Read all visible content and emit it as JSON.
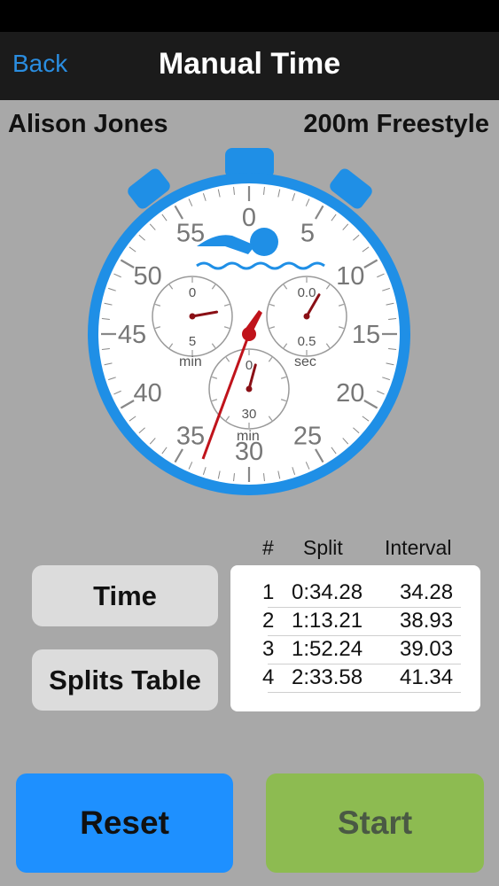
{
  "nav": {
    "back_label": "Back",
    "title": "Manual Time"
  },
  "swimmer": {
    "name": "Alison Jones",
    "event": "200m Freestyle"
  },
  "stopwatch": {
    "main_dial_labels": [
      "0",
      "5",
      "10",
      "15",
      "20",
      "25",
      "30",
      "35",
      "40",
      "45",
      "50",
      "55"
    ],
    "left_subdial": {
      "top": "0",
      "bottom": "5",
      "unit": "min"
    },
    "right_subdial": {
      "top": "0.0",
      "bottom": "0.5",
      "unit": "sec"
    },
    "bottom_subdial": {
      "top": "0",
      "bottom": "30",
      "unit": "min"
    },
    "colors": {
      "case": "#1f8fe6",
      "hand": "#c0131b",
      "swimmer_icon": "#1f8fe6"
    }
  },
  "buttons": {
    "time": "Time",
    "splits_table": "Splits Table",
    "reset": "Reset",
    "start": "Start"
  },
  "splits": {
    "headers": {
      "num": "#",
      "split": "Split",
      "interval": "Interval"
    },
    "rows": [
      {
        "num": "1",
        "split": "0:34.28",
        "interval": "34.28"
      },
      {
        "num": "2",
        "split": "1:13.21",
        "interval": "38.93"
      },
      {
        "num": "3",
        "split": "1:52.24",
        "interval": "39.03"
      },
      {
        "num": "4",
        "split": "2:33.58",
        "interval": "41.34"
      }
    ]
  }
}
